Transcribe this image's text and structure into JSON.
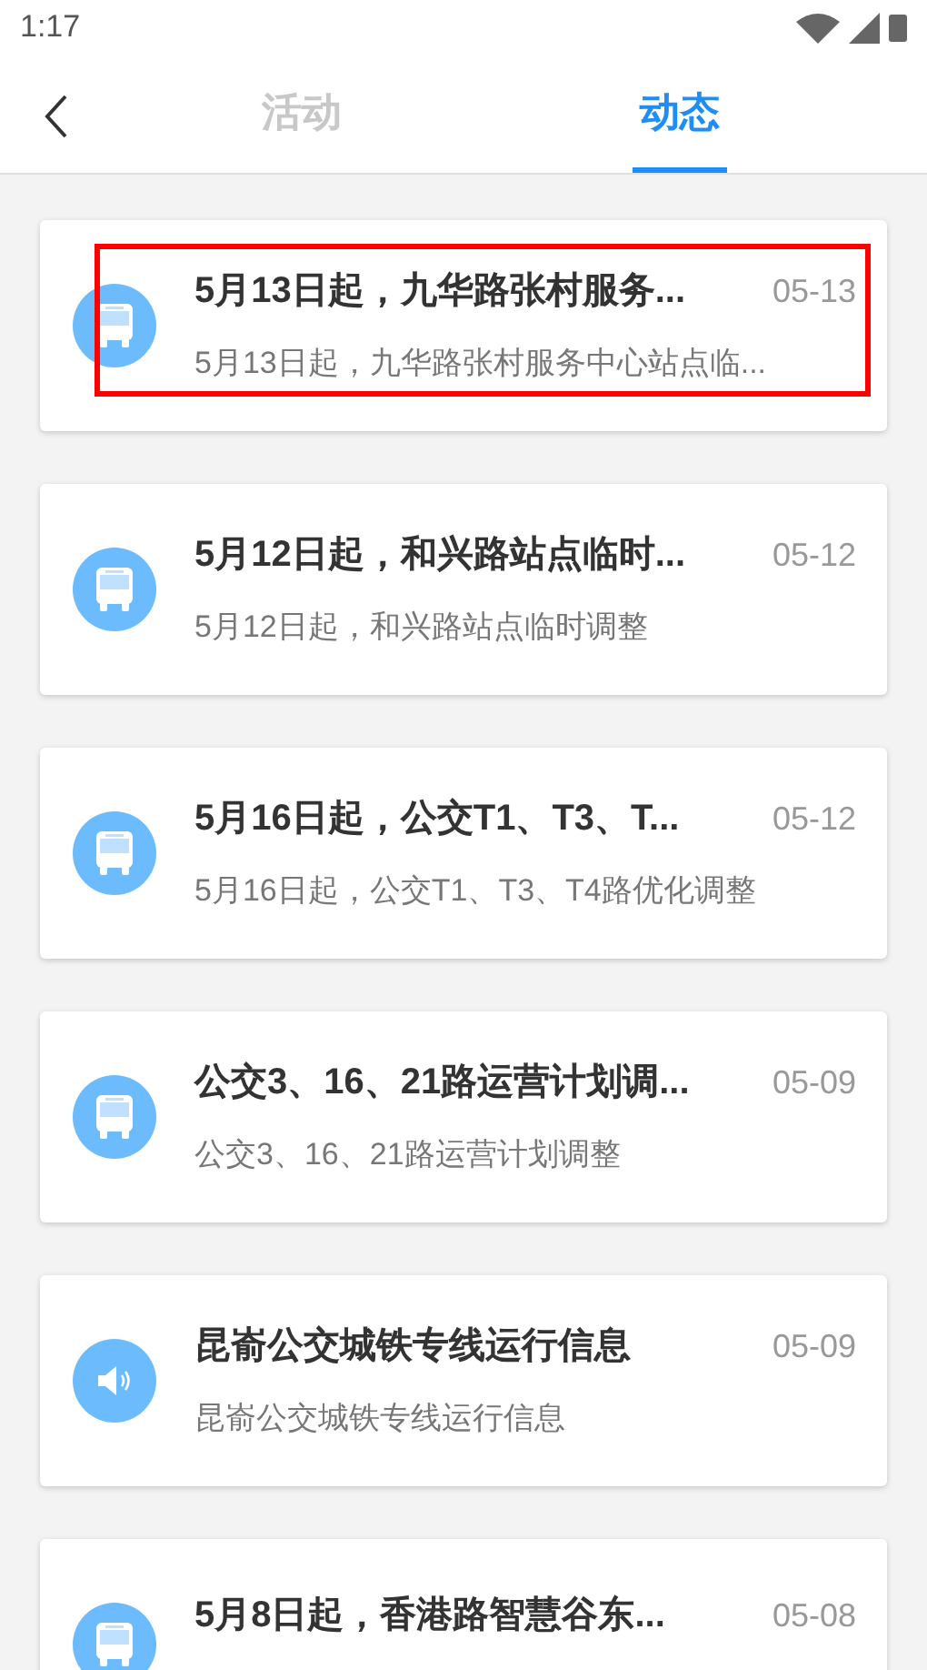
{
  "status_bar": {
    "time": "1:17"
  },
  "tabs": [
    {
      "label": "活动",
      "selected": false
    },
    {
      "label": "动态",
      "selected": true
    }
  ],
  "items": [
    {
      "kind": "bus",
      "title": "5月13日起，九华路张村服务...",
      "date": "05-13",
      "summary": "5月13日起，九华路张村服务中心站点临...",
      "highlighted": true
    },
    {
      "kind": "bus",
      "title": "5月12日起，和兴路站点临时...",
      "date": "05-12",
      "summary": "5月12日起，和兴路站点临时调整",
      "highlighted": false
    },
    {
      "kind": "bus",
      "title": "5月16日起，公交T1、T3、T...",
      "date": "05-12",
      "summary": "5月16日起，公交T1、T3、T4路优化调整",
      "highlighted": false
    },
    {
      "kind": "bus",
      "title": "公交3、16、21路运营计划调...",
      "date": "05-09",
      "summary": "公交3、16、21路运营计划调整",
      "highlighted": false
    },
    {
      "kind": "speaker",
      "title": "昆嵛公交城铁专线运行信息",
      "date": "05-09",
      "summary": "昆嵛公交城铁专线运行信息",
      "highlighted": false
    },
    {
      "kind": "bus",
      "title": "5月8日起，香港路智慧谷东...",
      "date": "05-08",
      "highlighted": false
    }
  ]
}
